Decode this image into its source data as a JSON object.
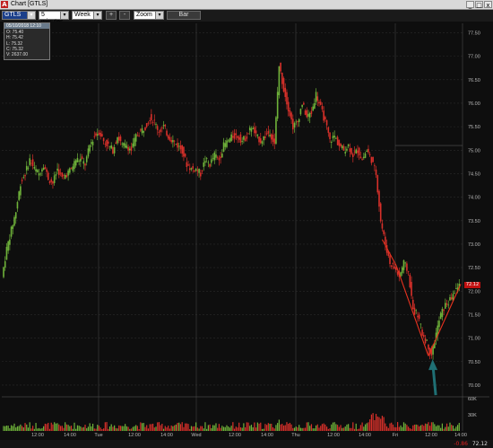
{
  "window": {
    "title": "Chart [GTLS]"
  },
  "toolbar": {
    "symbol": "GTLS",
    "interval": "5 minutes",
    "range": "Week",
    "plus_label": "+",
    "minus_label": "-",
    "zoom": "Zoom",
    "bar_label": "Bar"
  },
  "info": {
    "header": "05/10/2018 12:10",
    "open": "O: 75.40",
    "high": "H: 75.42",
    "low": "L: 75.32",
    "close": "C: 75.32",
    "volume": "V: 2637.00"
  },
  "last_price": {
    "change": "-0.86",
    "value": "72.12",
    "tag": "72.12"
  },
  "colors": {
    "up": "#6fb33a",
    "down": "#d8302a",
    "arrow": "#1f6f74",
    "tag": "#c01010"
  },
  "chart_data": {
    "type": "candlestick",
    "y_ticks": [
      "77.50",
      "77.00",
      "76.50",
      "76.00",
      "75.50",
      "75.00",
      "74.50",
      "74.00",
      "73.50",
      "73.00",
      "72.50",
      "72.00",
      "71.50",
      "71.00",
      "70.50",
      "70.00"
    ],
    "volume_ticks": [
      "60K",
      "30K"
    ],
    "x_ticks": [
      "12:00",
      "14:00",
      "Tue",
      "12:00",
      "14:00",
      "Wed",
      "12:00",
      "14:00",
      "Thu",
      "12:00",
      "14:00",
      "Fri",
      "12:00",
      "14:00"
    ],
    "ylim": [
      69.75,
      77.7
    ],
    "path": [
      [
        0,
        72.3
      ],
      [
        2,
        72.9
      ],
      [
        4,
        73.3
      ],
      [
        6,
        73.7
      ],
      [
        8,
        74.3
      ],
      [
        10,
        74.5
      ],
      [
        12,
        74.8
      ],
      [
        14,
        74.6
      ],
      [
        16,
        74.5
      ],
      [
        18,
        74.7
      ],
      [
        20,
        74.4
      ],
      [
        22,
        74.3
      ],
      [
        24,
        74.6
      ],
      [
        26,
        74.4
      ],
      [
        28,
        74.5
      ],
      [
        30,
        74.6
      ],
      [
        32,
        74.8
      ],
      [
        34,
        74.8
      ],
      [
        36,
        74.7
      ],
      [
        38,
        75.1
      ],
      [
        40,
        75.3
      ],
      [
        42,
        75.4
      ],
      [
        44,
        75.2
      ],
      [
        46,
        75.1
      ],
      [
        48,
        75.0
      ],
      [
        50,
        75.3
      ],
      [
        52,
        75.1
      ],
      [
        54,
        75.1
      ],
      [
        56,
        75.0
      ],
      [
        58,
        75.3
      ],
      [
        60,
        75.4
      ],
      [
        62,
        75.5
      ],
      [
        64,
        75.7
      ],
      [
        66,
        75.6
      ],
      [
        68,
        75.4
      ],
      [
        70,
        75.5
      ],
      [
        72,
        75.3
      ],
      [
        74,
        75.2
      ],
      [
        76,
        75.1
      ],
      [
        78,
        75.0
      ],
      [
        80,
        74.7
      ],
      [
        82,
        74.6
      ],
      [
        84,
        74.6
      ],
      [
        86,
        74.5
      ],
      [
        88,
        74.8
      ],
      [
        90,
        74.7
      ],
      [
        92,
        74.9
      ],
      [
        94,
        74.8
      ],
      [
        96,
        75.1
      ],
      [
        98,
        75.2
      ],
      [
        100,
        75.3
      ],
      [
        102,
        75.3
      ],
      [
        104,
        75.2
      ],
      [
        106,
        75.3
      ],
      [
        108,
        75.5
      ],
      [
        110,
        75.3
      ],
      [
        112,
        75.2
      ],
      [
        114,
        75.3
      ],
      [
        116,
        75.4
      ],
      [
        118,
        75.1
      ],
      [
        120,
        76.8
      ],
      [
        122,
        76.3
      ],
      [
        124,
        75.9
      ],
      [
        126,
        75.5
      ],
      [
        128,
        75.6
      ],
      [
        130,
        76.0
      ],
      [
        132,
        75.7
      ],
      [
        134,
        75.8
      ],
      [
        136,
        76.2
      ],
      [
        138,
        75.9
      ],
      [
        140,
        75.6
      ],
      [
        142,
        75.2
      ],
      [
        144,
        75.3
      ],
      [
        146,
        75.1
      ],
      [
        148,
        75.0
      ],
      [
        150,
        75.1
      ],
      [
        152,
        74.9
      ],
      [
        154,
        75.0
      ],
      [
        156,
        74.8
      ],
      [
        158,
        75.0
      ],
      [
        160,
        74.8
      ],
      [
        162,
        74.5
      ],
      [
        164,
        73.5
      ],
      [
        166,
        73.0
      ],
      [
        168,
        72.6
      ],
      [
        170,
        72.5
      ],
      [
        172,
        72.3
      ],
      [
        174,
        72.6
      ],
      [
        176,
        72.4
      ],
      [
        178,
        71.6
      ],
      [
        180,
        71.5
      ],
      [
        182,
        71.1
      ],
      [
        184,
        70.9
      ],
      [
        186,
        70.65
      ],
      [
        188,
        71.1
      ],
      [
        190,
        71.5
      ],
      [
        192,
        71.7
      ],
      [
        194,
        71.8
      ],
      [
        196,
        72.0
      ],
      [
        198,
        72.12
      ]
    ],
    "annotation": "arrow pointing to low near 70.55"
  }
}
